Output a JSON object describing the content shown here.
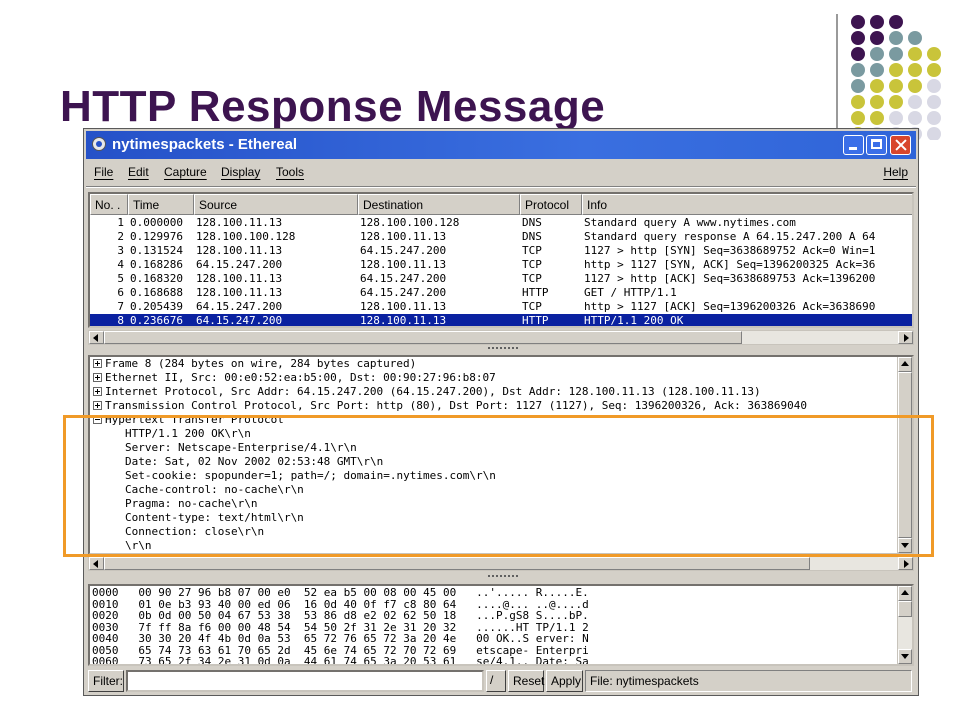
{
  "slide": {
    "title": "HTTP Response Message"
  },
  "window": {
    "title": "nytimespackets - Ethereal"
  },
  "menu": {
    "file": "File",
    "edit": "Edit",
    "capture": "Capture",
    "display": "Display",
    "tools": "Tools",
    "help": "Help"
  },
  "packet_list": {
    "columns": [
      "No. .",
      "Time",
      "Source",
      "Destination",
      "Protocol",
      "Info"
    ],
    "rows": [
      {
        "no": "1",
        "time": "0.000000",
        "src": "128.100.11.13",
        "dst": "128.100.100.128",
        "proto": "DNS",
        "info": "Standard query A www.nytimes.com"
      },
      {
        "no": "2",
        "time": "0.129976",
        "src": "128.100.100.128",
        "dst": "128.100.11.13",
        "proto": "DNS",
        "info": "Standard query response A 64.15.247.200 A 64"
      },
      {
        "no": "3",
        "time": "0.131524",
        "src": "128.100.11.13",
        "dst": "64.15.247.200",
        "proto": "TCP",
        "info": "1127 > http [SYN] Seq=3638689752 Ack=0 Win=1"
      },
      {
        "no": "4",
        "time": "0.168286",
        "src": "64.15.247.200",
        "dst": "128.100.11.13",
        "proto": "TCP",
        "info": "http > 1127 [SYN, ACK] Seq=1396200325 Ack=36"
      },
      {
        "no": "5",
        "time": "0.168320",
        "src": "128.100.11.13",
        "dst": "64.15.247.200",
        "proto": "TCP",
        "info": "1127 > http [ACK] Seq=3638689753 Ack=1396200"
      },
      {
        "no": "6",
        "time": "0.168688",
        "src": "128.100.11.13",
        "dst": "64.15.247.200",
        "proto": "HTTP",
        "info": "GET / HTTP/1.1"
      },
      {
        "no": "7",
        "time": "0.205439",
        "src": "64.15.247.200",
        "dst": "128.100.11.13",
        "proto": "TCP",
        "info": "http > 1127 [ACK] Seq=1396200326 Ack=3638690"
      },
      {
        "no": "8",
        "time": "0.236676",
        "src": "64.15.247.200",
        "dst": "128.100.11.13",
        "proto": "HTTP",
        "info": "HTTP/1.1 200 OK"
      }
    ],
    "selected_row": 8
  },
  "detail": {
    "lines": [
      "Frame 8 (284 bytes on wire, 284 bytes captured)",
      "Ethernet II, Src: 00:e0:52:ea:b5:00, Dst: 00:90:27:96:b8:07",
      "Internet Protocol, Src Addr: 64.15.247.200 (64.15.247.200), Dst Addr: 128.100.11.13 (128.100.11.13)",
      "Transmission Control Protocol, Src Port: http (80), Dst Port: 1127 (1127), Seq: 1396200326, Ack: 363869040",
      "Hypertext Transfer Protocol",
      "HTTP/1.1 200 OK\\r\\n",
      "Server: Netscape-Enterprise/4.1\\r\\n",
      "Date: Sat, 02 Nov 2002 02:53:48 GMT\\r\\n",
      "Set-cookie: spopunder=1; path=/; domain=.nytimes.com\\r\\n",
      "Cache-control: no-cache\\r\\n",
      "Pragma: no-cache\\r\\n",
      "Content-type: text/html\\r\\n",
      "Connection: close\\r\\n",
      "\\r\\n"
    ]
  },
  "hex": {
    "lines": [
      "0000   00 90 27 96 b8 07 00 e0  52 ea b5 00 08 00 45 00   ..'..... R.....E.",
      "0010   01 0e b3 93 40 00 ed 06  16 0d 40 0f f7 c8 80 64   ....@... ..@....d",
      "0020   0b 0d 00 50 04 67 53 38  53 86 d8 e2 02 62 50 18   ...P.gS8 S....bP.",
      "0030   7f ff 8a f6 00 00 48 54  54 50 2f 31 2e 31 20 32   ......HT TP/1.1 2",
      "0040   30 30 20 4f 4b 0d 0a 53  65 72 76 65 72 3a 20 4e   00 OK..S erver: N",
      "0050   65 74 73 63 61 70 65 2d  45 6e 74 65 72 70 72 69   etscape- Enterpri",
      "0060   73 65 2f 34 2e 31 0d 0a  44 61 74 65 3a 20 53 61   se/4.1.. Date: Sa"
    ]
  },
  "filter": {
    "label": "Filter:",
    "value": "",
    "reset": "Reset",
    "apply": "Apply",
    "status": "File: nytimespackets"
  },
  "colors": {
    "title": "#3d1450",
    "selected_row": "#0a21a0",
    "highlight": "#f09a28",
    "titlebar": "#2551c8"
  }
}
